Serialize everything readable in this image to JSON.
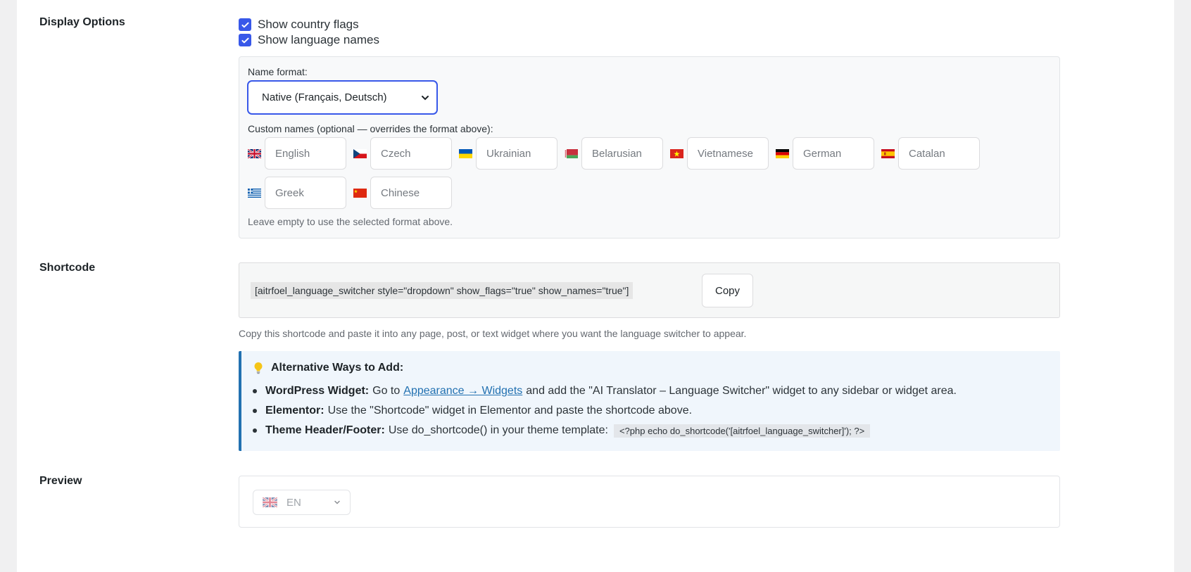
{
  "display_options": {
    "label": "Display Options",
    "show_flags": {
      "label": "Show country flags",
      "checked": true
    },
    "show_names": {
      "label": "Show language names",
      "checked": true
    },
    "name_format": {
      "label": "Name format:",
      "value": "Native (Français, Deutsch)"
    },
    "custom_names_label": "Custom names (optional — overrides the format above):",
    "languages": [
      {
        "flag": "uk-flag-icon",
        "placeholder": "English"
      },
      {
        "flag": "czech-flag-icon",
        "placeholder": "Czech"
      },
      {
        "flag": "ukraine-flag-icon",
        "placeholder": "Ukrainian"
      },
      {
        "flag": "belarus-flag-icon",
        "placeholder": "Belarusian"
      },
      {
        "flag": "vietnam-flag-icon",
        "placeholder": "Vietnamese"
      },
      {
        "flag": "germany-flag-icon",
        "placeholder": "German"
      },
      {
        "flag": "catalonia-flag-icon",
        "placeholder": "Catalan"
      },
      {
        "flag": "greece-flag-icon",
        "placeholder": "Greek"
      },
      {
        "flag": "china-flag-icon",
        "placeholder": "Chinese"
      }
    ],
    "hint": "Leave empty to use the selected format above."
  },
  "shortcode": {
    "label": "Shortcode",
    "code": "[aitrfoel_language_switcher style=\"dropdown\" show_flags=\"true\" show_names=\"true\"]",
    "copy_label": "Copy",
    "help": "Copy this shortcode and paste it into any page, post, or text widget where you want the language switcher to appear."
  },
  "alternatives": {
    "icon": "lightbulb-icon",
    "title": "Alternative Ways to Add:",
    "items": [
      {
        "bold": "WordPress Widget:",
        "pre": "Go to",
        "link": "Appearance → Widgets",
        "post": "and add the \"AI Translator – Language Switcher\" widget to any sidebar or widget area."
      },
      {
        "bold": "Elementor:",
        "pre": "Use the \"Shortcode\" widget in Elementor and paste the shortcode above."
      },
      {
        "bold": "Theme Header/Footer:",
        "pre": "Use do_shortcode() in your theme template:",
        "code": "<?php echo do_shortcode('[aitrfoel_language_switcher]'); ?>"
      }
    ]
  },
  "preview": {
    "label": "Preview",
    "flag": "uk-flag-icon",
    "value": "EN"
  },
  "colors": {
    "accent": "#3858e9",
    "link": "#2271b1"
  }
}
